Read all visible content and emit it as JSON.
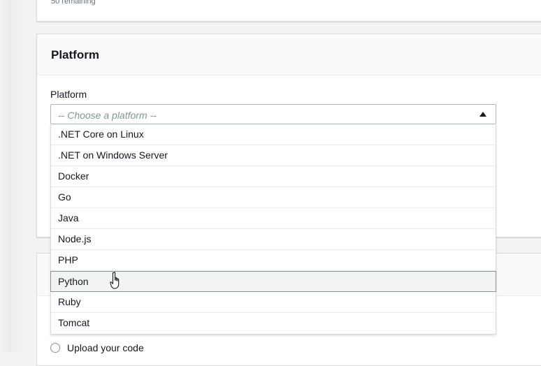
{
  "previous_section": {
    "remaining_text": "50 remaining"
  },
  "platform_section": {
    "title": "Platform",
    "field_label": "Platform",
    "select": {
      "placeholder": "-- Choose a platform --",
      "expanded": true
    },
    "options": [
      ".NET Core on Linux",
      ".NET on Windows Server",
      "Docker",
      "Go",
      "Java",
      "Node.js",
      "PHP",
      "Python",
      "Ruby",
      "Tomcat"
    ],
    "hovered_option": "Python"
  },
  "application_code_section": {
    "upload_option_label": "Upload your code"
  },
  "icons": {
    "caret": "caret-up-icon",
    "cursor": "hand-pointer-icon"
  },
  "colors": {
    "border": "#d5dbdb",
    "hover_background": "#f2f3f3",
    "placeholder": "#879596",
    "text": "#16191f"
  }
}
